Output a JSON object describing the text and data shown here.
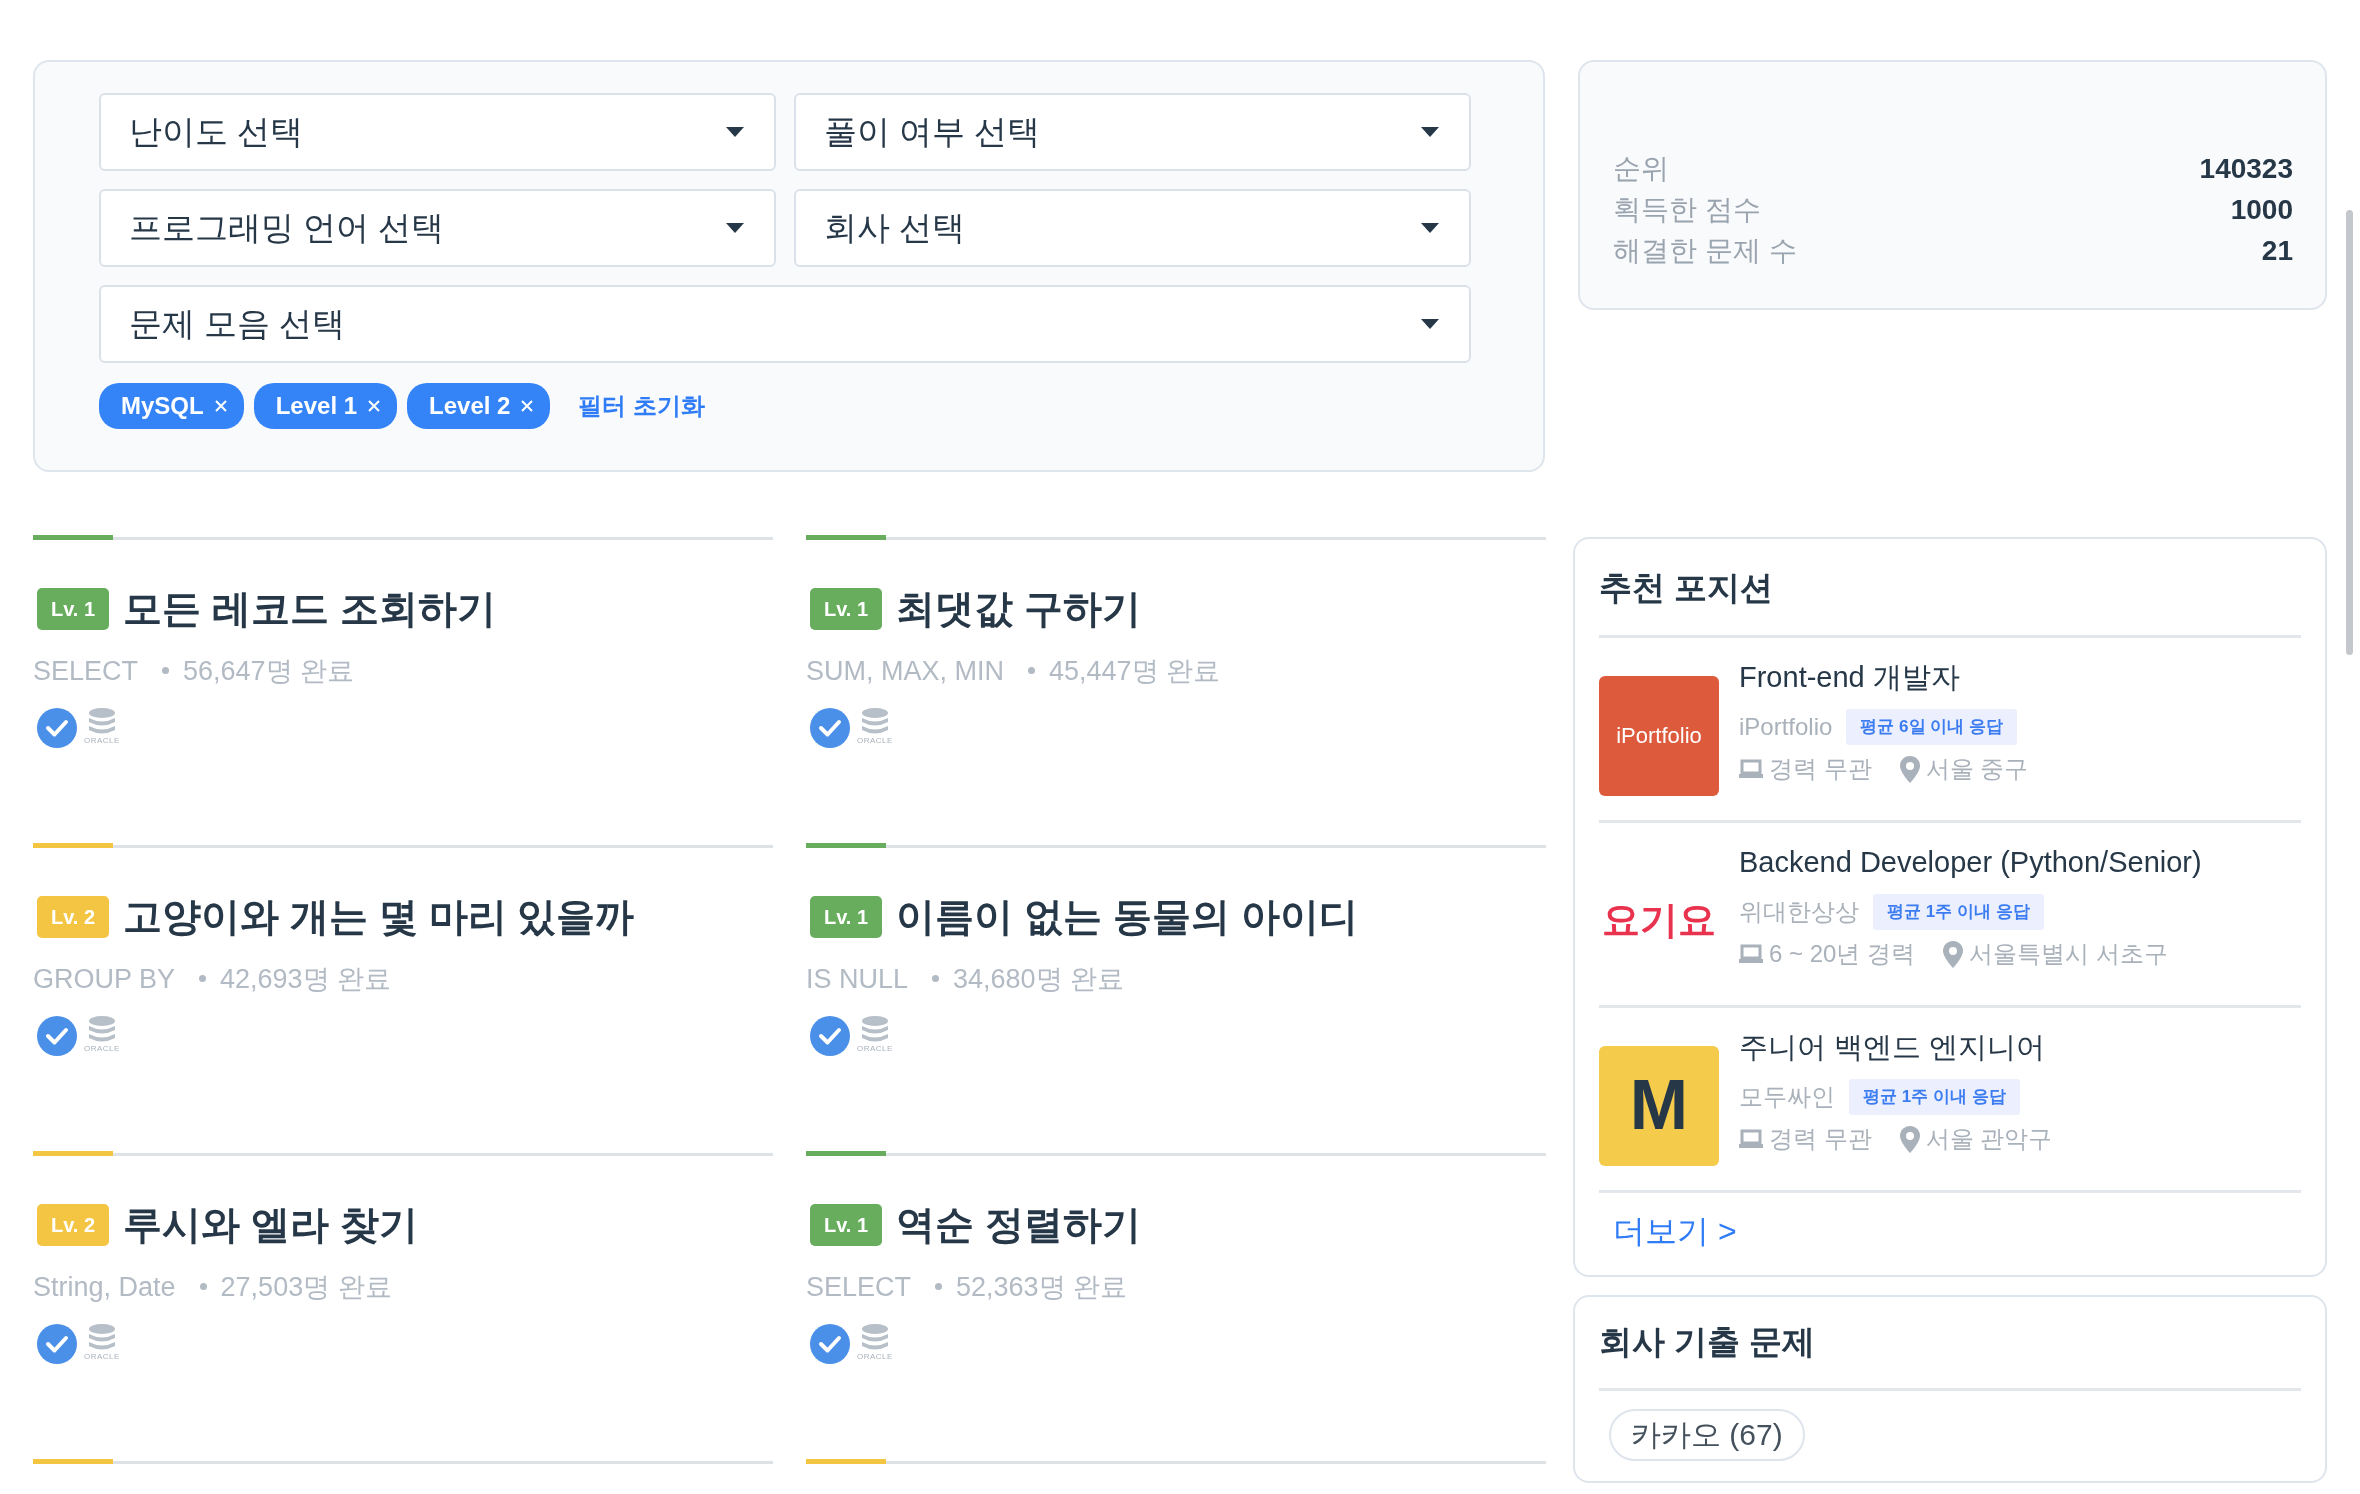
{
  "filters": {
    "selects": [
      {
        "placeholder": "난이도 선택",
        "wide": false
      },
      {
        "placeholder": "풀이 여부 선택",
        "wide": false
      },
      {
        "placeholder": "프로그래밍 언어 선택",
        "wide": false
      },
      {
        "placeholder": "회사 선택",
        "wide": false
      },
      {
        "placeholder": "문제 모음 선택",
        "wide": true
      }
    ],
    "chips": [
      "MySQL",
      "Level 1",
      "Level 2"
    ],
    "reset": "필터 초기화"
  },
  "stats": [
    {
      "label": "순위",
      "value": "140323"
    },
    {
      "label": "획득한 점수",
      "value": "1000"
    },
    {
      "label": "해결한 문제 수",
      "value": "21"
    }
  ],
  "problems": [
    {
      "level": "Lv. 1",
      "color": "#68ad5d",
      "title": "모든 레코드 조회하기",
      "tags": "SELECT",
      "count": "56,647명 완료",
      "solved": true,
      "db_label": "ORACLE"
    },
    {
      "level": "Lv. 1",
      "color": "#68ad5d",
      "title": "최댓값 구하기",
      "tags": "SUM, MAX, MIN",
      "count": "45,447명 완료",
      "solved": true,
      "db_label": "ORACLE"
    },
    {
      "level": "Lv. 2",
      "color": "#f4c542",
      "title": "고양이와 개는 몇 마리 있을까",
      "tags": "GROUP BY",
      "count": "42,693명 완료",
      "solved": true,
      "db_label": "ORACLE"
    },
    {
      "level": "Lv. 1",
      "color": "#68ad5d",
      "title": "이름이 없는 동물의 아이디",
      "tags": "IS NULL",
      "count": "34,680명 완료",
      "solved": true,
      "db_label": "ORACLE"
    },
    {
      "level": "Lv. 2",
      "color": "#f4c542",
      "title": "루시와 엘라 찾기",
      "tags": "String, Date",
      "count": "27,503명 완료",
      "solved": true,
      "db_label": "ORACLE"
    },
    {
      "level": "Lv. 1",
      "color": "#68ad5d",
      "title": "역순 정렬하기",
      "tags": "SELECT",
      "count": "52,363명 완료",
      "solved": true,
      "db_label": "ORACLE"
    },
    {
      "color": "#f4c542"
    },
    {
      "color": "#f4c542"
    }
  ],
  "positions": {
    "title": "추천 포지션",
    "items": [
      {
        "logo": {
          "kind": "box",
          "text": "iPortfolio",
          "color": "#dd5b3c"
        },
        "title": "Front-end 개발자",
        "company": "iPortfolio",
        "badge": "평균 6일 이내 응답",
        "career": "경력 무관",
        "location": "서울 중구"
      },
      {
        "logo": {
          "kind": "wordmark",
          "text": "요기요",
          "color": "#e8324e"
        },
        "title": "Backend Developer (Python/Senior)",
        "company": "위대한상상",
        "badge": "평균 1주 이내 응답",
        "career": "6 ~ 20년 경력",
        "location": "서울특별시 서초구"
      },
      {
        "logo": {
          "kind": "box",
          "text": "M",
          "color": "#f5cb4c"
        },
        "title": "주니어 백엔드 엔지니어",
        "company": "모두싸인",
        "badge": "평균 1주 이내 응답",
        "career": "경력 무관",
        "location": "서울 관악구"
      }
    ],
    "more": "더보기 >"
  },
  "companies": {
    "title": "회사 기출 문제",
    "items": [
      "카카오 (67)"
    ]
  }
}
